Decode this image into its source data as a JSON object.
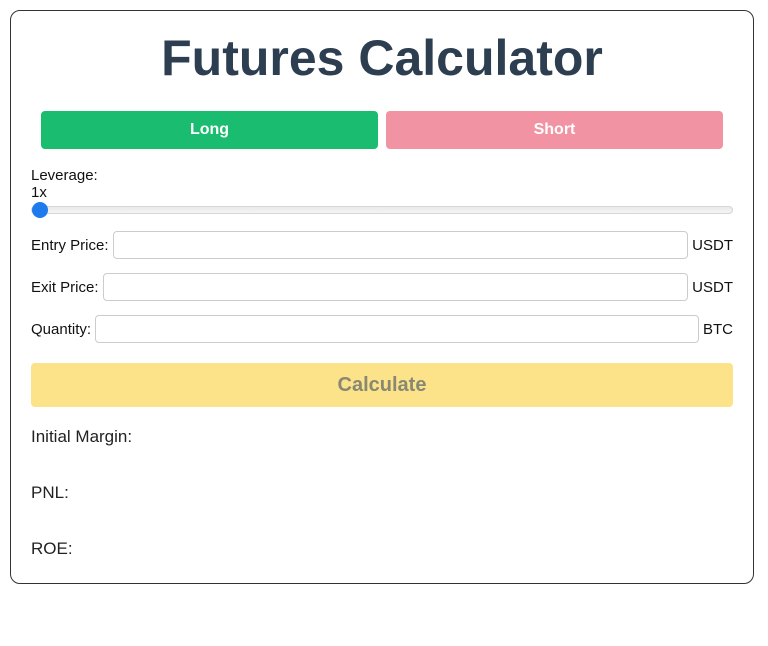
{
  "title": "Futures Calculator",
  "buttons": {
    "long": "Long",
    "short": "Short",
    "calculate": "Calculate"
  },
  "leverage": {
    "label": "Leverage:",
    "value_display": "1x",
    "slider_value": 1,
    "slider_min": 1,
    "slider_max": 100
  },
  "inputs": {
    "entry": {
      "label": "Entry Price:",
      "value": "",
      "unit": "USDT"
    },
    "exit": {
      "label": "Exit Price:",
      "value": "",
      "unit": "USDT"
    },
    "quantity": {
      "label": "Quantity:",
      "value": "",
      "unit": "BTC"
    }
  },
  "results": {
    "initial_margin": {
      "label": "Initial Margin:",
      "value": ""
    },
    "pnl": {
      "label": "PNL:",
      "value": ""
    },
    "roe": {
      "label": "ROE:",
      "value": ""
    }
  }
}
